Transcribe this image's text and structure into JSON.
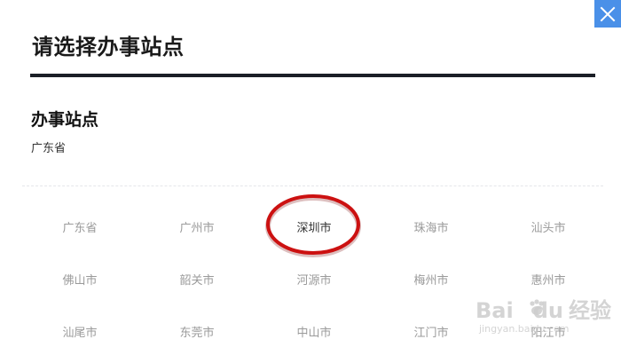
{
  "dialog": {
    "title": "请选择办事站点"
  },
  "section": {
    "title": "办事站点",
    "selected_path": "广东省"
  },
  "locations": [
    {
      "label": "广东省",
      "selected": false
    },
    {
      "label": "广州市",
      "selected": false
    },
    {
      "label": "深圳市",
      "selected": true
    },
    {
      "label": "珠海市",
      "selected": false
    },
    {
      "label": "汕头市",
      "selected": false
    },
    {
      "label": "佛山市",
      "selected": false
    },
    {
      "label": "韶关市",
      "selected": false
    },
    {
      "label": "河源市",
      "selected": false
    },
    {
      "label": "梅州市",
      "selected": false
    },
    {
      "label": "惠州市",
      "selected": false
    },
    {
      "label": "汕尾市",
      "selected": false
    },
    {
      "label": "东莞市",
      "selected": false
    },
    {
      "label": "中山市",
      "selected": false
    },
    {
      "label": "江门市",
      "selected": false
    },
    {
      "label": "阳江市",
      "selected": false
    }
  ],
  "watermark": {
    "brand": "Baidu",
    "cn": "经验",
    "url": "jingyan.baidu.com"
  },
  "colors": {
    "close_button": "#4a90e8",
    "title_rule": "#1b1f27",
    "annotation_ring": "#cc1111",
    "inactive_text": "#9a9a9a",
    "selected_text": "#333333"
  },
  "icons": {
    "close": "close-icon",
    "annotation": "red-ellipse-annotation"
  }
}
